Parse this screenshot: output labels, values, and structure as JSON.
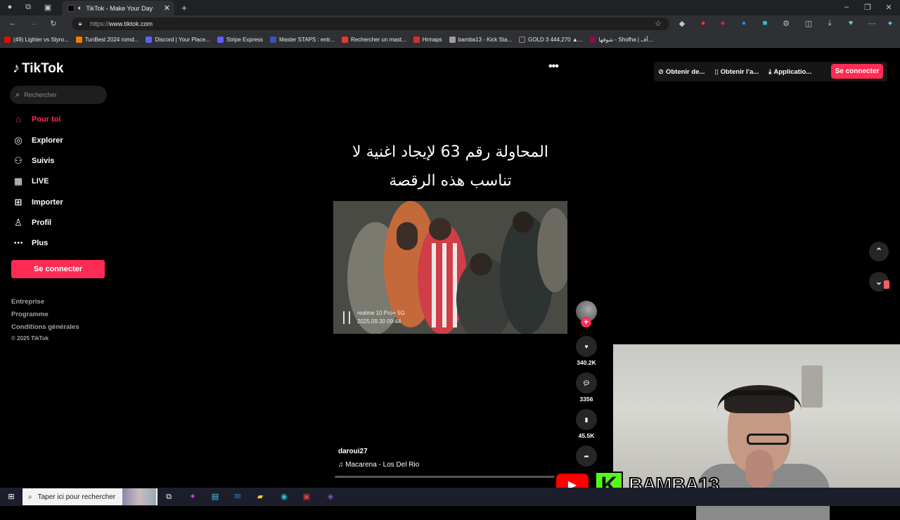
{
  "browser": {
    "tab_title": "TikTok - Make Your Day",
    "url_proto": "https://",
    "url_host": "www.tiktok.com",
    "bookmarks": [
      {
        "label": "(49) Lighter vs Styro...",
        "color": "#ff0000"
      },
      {
        "label": "TunBest 2024 romd...",
        "color": "#f57c00"
      },
      {
        "label": "Discord | Your Place...",
        "color": "#5865f2"
      },
      {
        "label": "Stripe Express",
        "color": "#635bff"
      },
      {
        "label": "Master STAPS : entr...",
        "color": "#3f51b5"
      },
      {
        "label": "Rechercher un mast...",
        "color": "#e53935"
      },
      {
        "label": "Hrmaps",
        "color": "#d32f2f"
      },
      {
        "label": "bamba13 - Kick Sta...",
        "color": "#9e9e9e"
      },
      {
        "label": "GOLD 3 444,270 ▲...",
        "color": "#333333"
      },
      {
        "label": "شوفها - Shofha | أف...",
        "color": "#880e4f"
      }
    ]
  },
  "sidebar": {
    "logo": "TikTok",
    "search_placeholder": "Rechercher",
    "nav": [
      {
        "label": "Pour toi",
        "icon": "home-icon",
        "active": true
      },
      {
        "label": "Explorer",
        "icon": "compass-icon"
      },
      {
        "label": "Suivis",
        "icon": "following-icon"
      },
      {
        "label": "LIVE",
        "icon": "live-icon"
      },
      {
        "label": "Importer",
        "icon": "upload-icon"
      },
      {
        "label": "Profil",
        "icon": "profile-icon"
      },
      {
        "label": "Plus",
        "icon": "more-icon"
      }
    ],
    "signin_label": "Se connecter",
    "footer_links": [
      "Entreprise",
      "Programme",
      "Conditions générales"
    ],
    "copyright": "© 2025 TikTok"
  },
  "topbar": {
    "buttons": [
      "Obtenir de...",
      "Obtenir l'a...",
      "Applicatio..."
    ],
    "signin_label": "Se connecter"
  },
  "video": {
    "caption": "المحاولة رقم 63 لإيجاد اغنية لا تناسب هذه الرقصة",
    "watermark_device": "realme 10 Pro+ 5G",
    "watermark_date": "2025.09.30 09:44",
    "author": "daroui27",
    "music": "Macarena - Los Del Rio",
    "likes": "340.2K",
    "comments": "3356",
    "saves": "45.5K",
    "shares": "..."
  },
  "overlay": {
    "channel_name": "BAMBA13",
    "kick_letter": "K"
  },
  "taskbar": {
    "search_placeholder": "Taper ici pour rechercher"
  },
  "colors": {
    "accent": "#fe2c55",
    "background": "#000000"
  }
}
